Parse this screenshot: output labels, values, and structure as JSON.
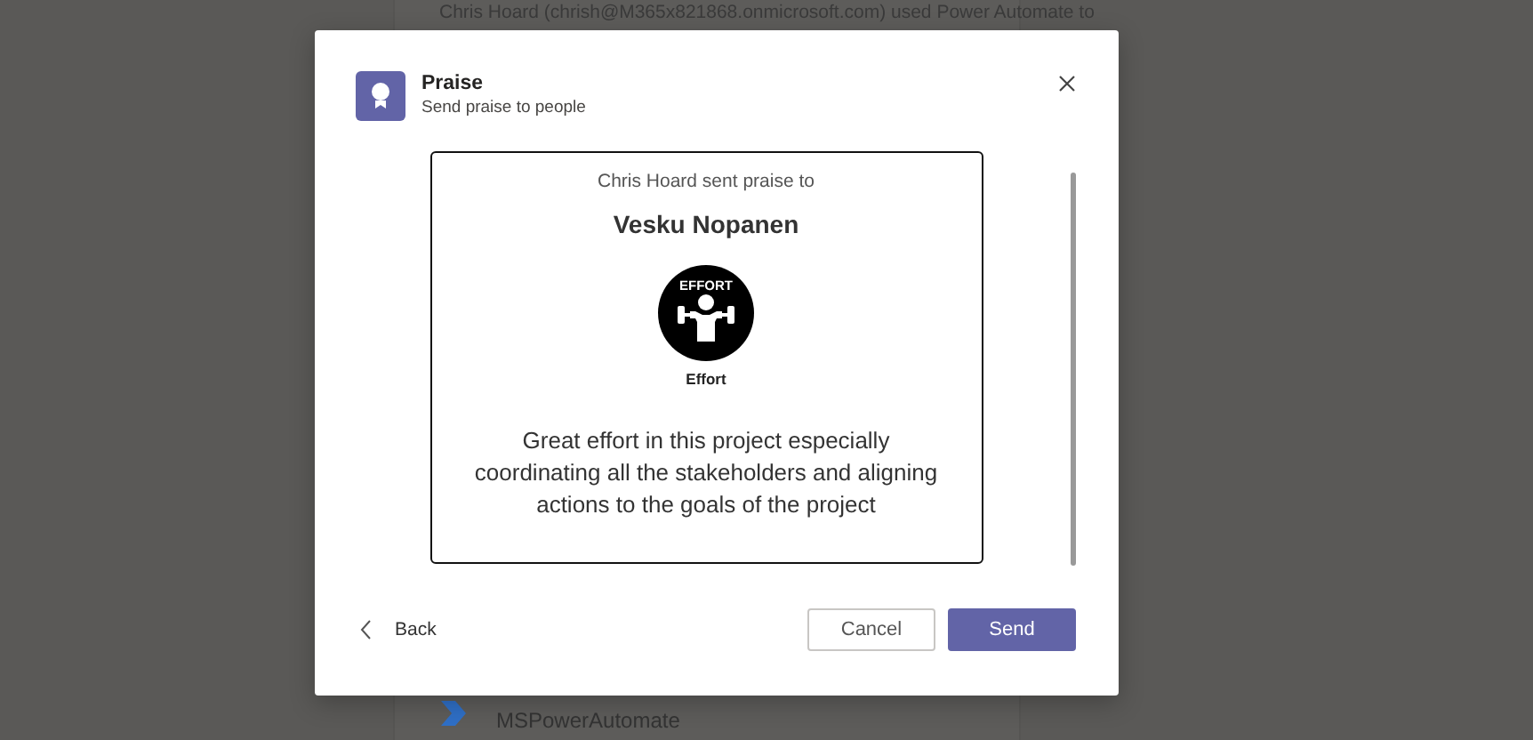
{
  "background": {
    "post_text": "Chris Hoard (chrish@M365x821868.onmicrosoft.com) used Power Automate to",
    "app_handle": "MSPowerAutomate"
  },
  "dialog": {
    "title": "Praise",
    "subtitle": "Send praise to people",
    "card": {
      "sender_line": "Chris Hoard sent praise to",
      "recipient": "Vesku Nopanen",
      "badge_label": "EFFORT",
      "badge_name": "Effort",
      "message": "Great effort in this project especially coordinating all the stakeholders and aligning actions to the goals of the project"
    },
    "back": "Back",
    "buttons": [
      {
        "label": "Cancel",
        "kind": "secondary"
      },
      {
        "label": "Send",
        "kind": "primary"
      }
    ]
  }
}
